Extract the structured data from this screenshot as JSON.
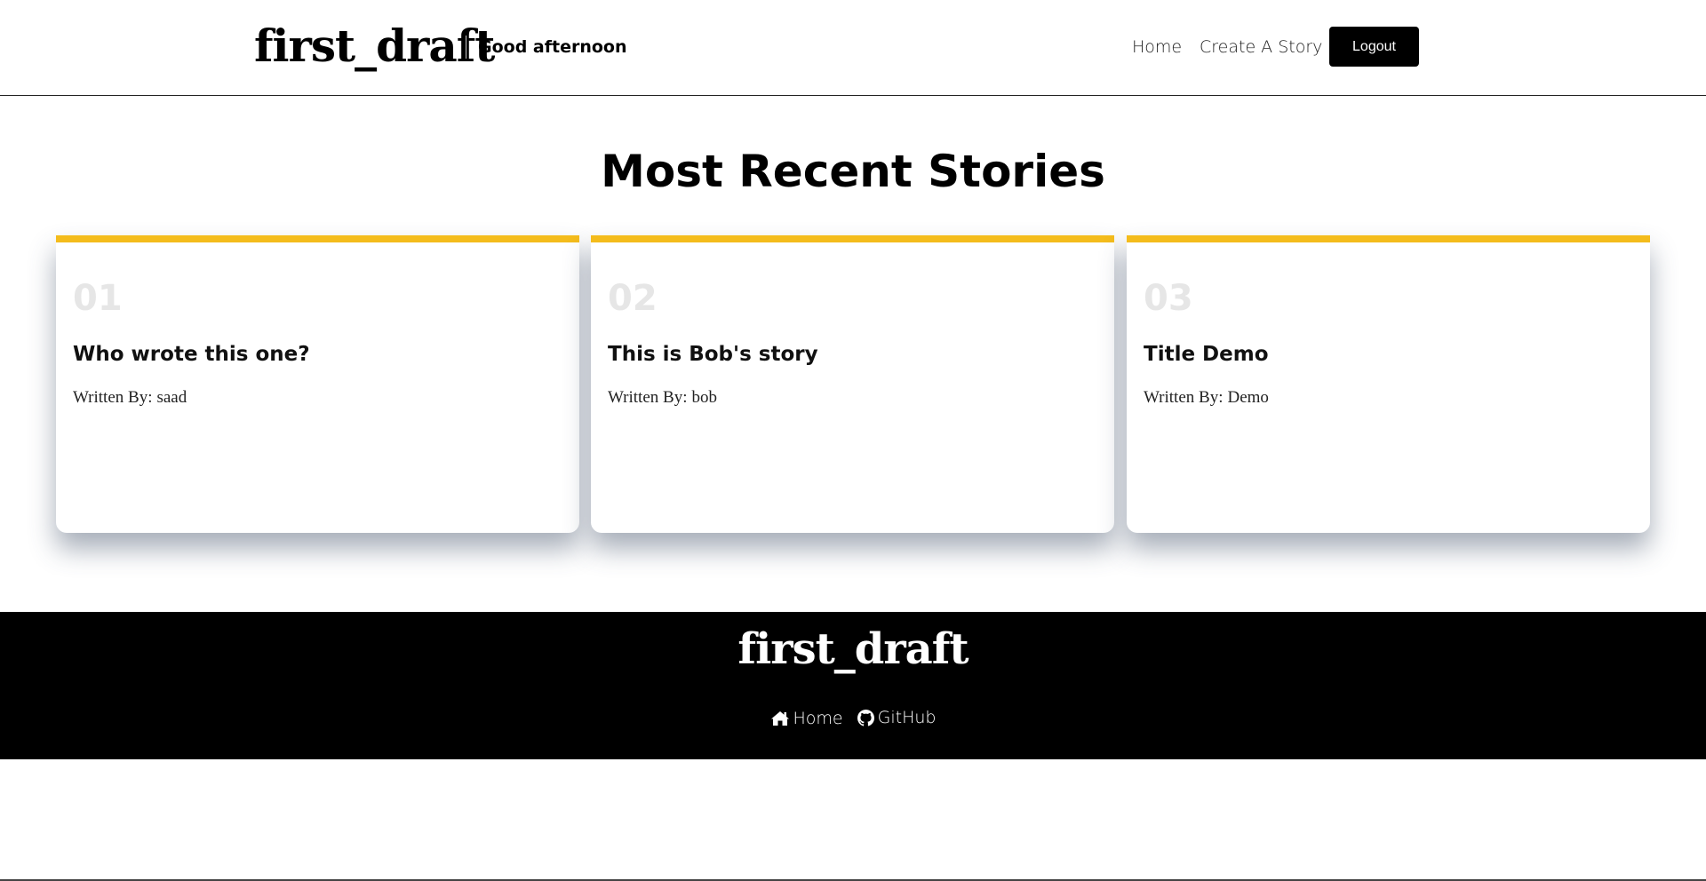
{
  "header": {
    "brand": "first_draft",
    "greeting": "Good afternoon",
    "nav": {
      "home": "Home",
      "create": "Create A Story"
    },
    "logout_label": "Logout"
  },
  "main": {
    "title": "Most Recent Stories",
    "stories": [
      {
        "number": "01",
        "title": "Who wrote this one?",
        "author_prefix": "Written By:",
        "author": "saad"
      },
      {
        "number": "02",
        "title": "This is Bob's story",
        "author_prefix": "Written By:",
        "author": "bob"
      },
      {
        "number": "03",
        "title": "Title Demo",
        "author_prefix": "Written By:",
        "author": "Demo"
      }
    ]
  },
  "footer": {
    "brand": "first_draft",
    "links": [
      {
        "icon": "home-icon",
        "label": "Home"
      },
      {
        "icon": "github-icon",
        "label": "GitHub"
      }
    ]
  },
  "colors": {
    "accent": "#f4bc1c",
    "footer_bg": "#000000",
    "number_gray": "#e6e6e6"
  }
}
